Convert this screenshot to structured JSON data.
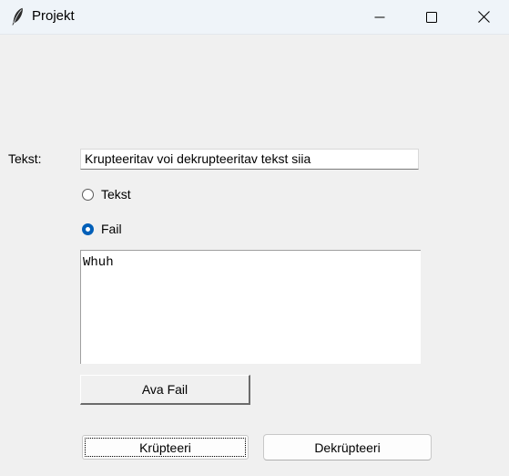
{
  "window": {
    "title": "Projekt",
    "icon": "feather-icon",
    "controls": [
      "minimize-icon",
      "maximize-icon",
      "close-icon"
    ]
  },
  "form": {
    "text_label": "Tekst:",
    "text_input_value": "Krupteeritav voi dekrupteeritav tekst siia",
    "radio_options": [
      {
        "label": "Tekst",
        "selected": false
      },
      {
        "label": "Fail",
        "selected": true
      }
    ],
    "textarea_value": "Whuh",
    "open_file_button": "Ava Fail",
    "encrypt_button": "Krüpteeri",
    "decrypt_button": "Dekrüpteeri"
  },
  "colors": {
    "accent": "#005fb8",
    "titlebar": "#eff4f9",
    "window_bg": "#f0f0f0"
  }
}
